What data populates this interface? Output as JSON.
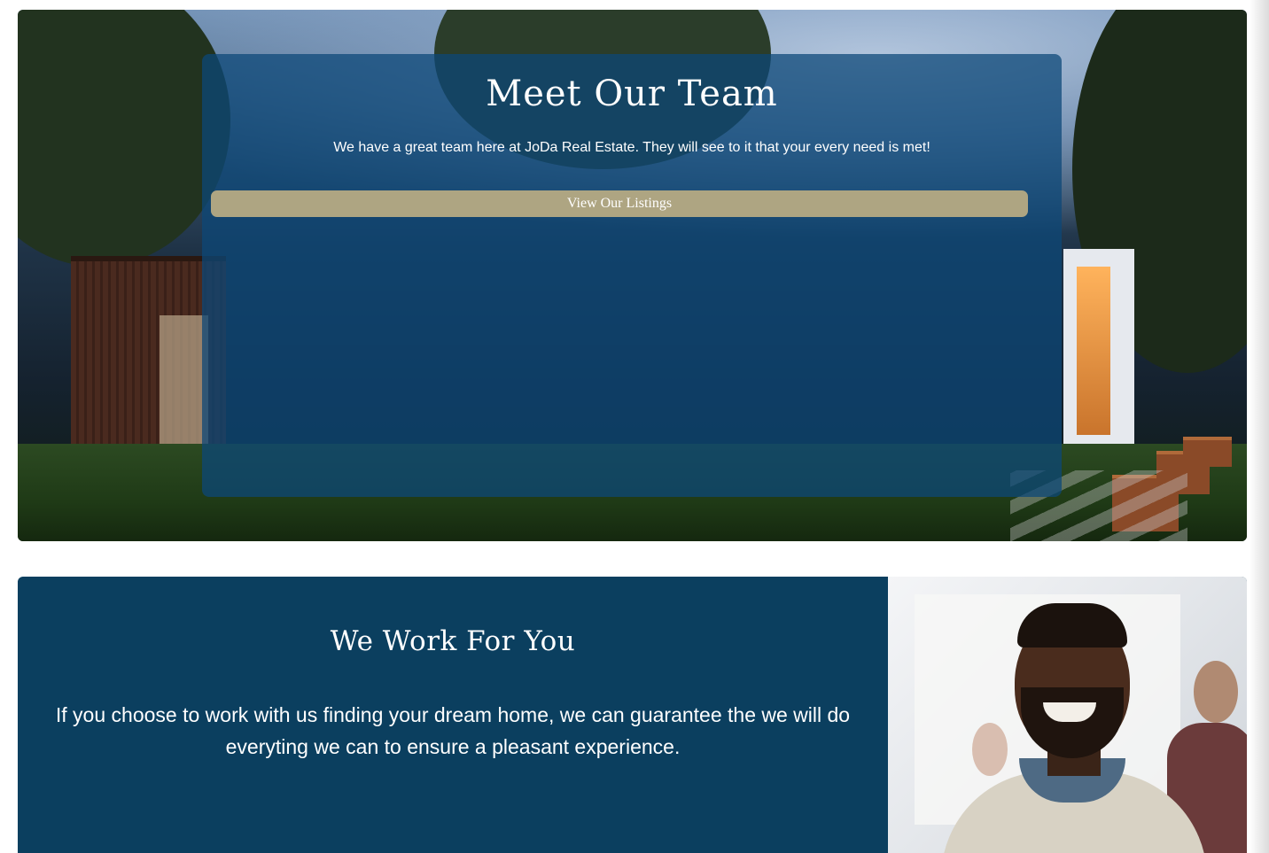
{
  "hero": {
    "title": "Meet Our Team",
    "subtitle": "We have a great team here at JoDa Real Estate. They will see to it that your every need is met!",
    "button_label": "View Our Listings",
    "image": "modern-house-backyard-photo"
  },
  "work": {
    "title": "We Work For You",
    "text": "If you choose to work with us finding your dream home, we can guarantee the we will do everyting we can to ensure a pleasant experience.",
    "image": "smiling-man-portrait-photo"
  },
  "colors": {
    "overlay_blue": "#0c4878",
    "section_blue": "#0b3f5f",
    "button_khaki": "#aea582",
    "text_white": "#ffffff"
  }
}
